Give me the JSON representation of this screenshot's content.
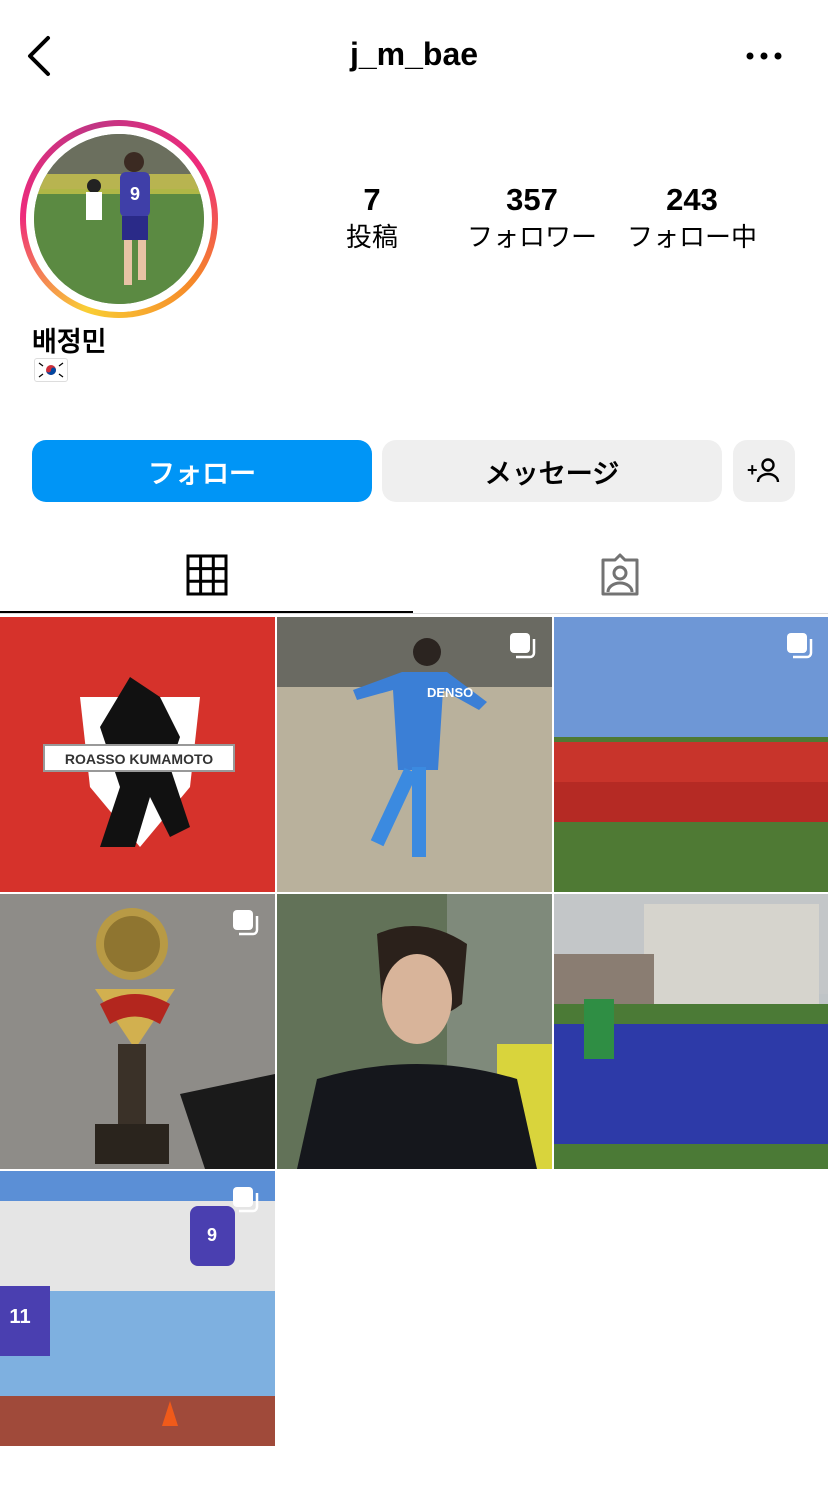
{
  "header": {
    "username": "j_m_bae"
  },
  "profile": {
    "display_name": "배정민",
    "bio_flag": "🇰🇷",
    "stats": [
      {
        "value": "7",
        "label": "投稿"
      },
      {
        "value": "357",
        "label": "フォロワー"
      },
      {
        "value": "243",
        "label": "フォロー中"
      }
    ]
  },
  "actions": {
    "follow_label": "フォロー",
    "message_label": "メッセージ"
  },
  "posts": [
    {
      "logo_text": "ROASSO KUMAMOTO",
      "multi": false
    },
    {
      "shirt_text": "DENSO",
      "multi": true
    },
    {
      "multi": true
    },
    {
      "multi": true
    },
    {
      "multi": false
    },
    {
      "multi": false
    },
    {
      "jersey_numbers": "11",
      "multi": true
    }
  ],
  "colors": {
    "accent": "#0095f6",
    "button_gray": "#efefef",
    "logo_red": "#d6322b"
  }
}
